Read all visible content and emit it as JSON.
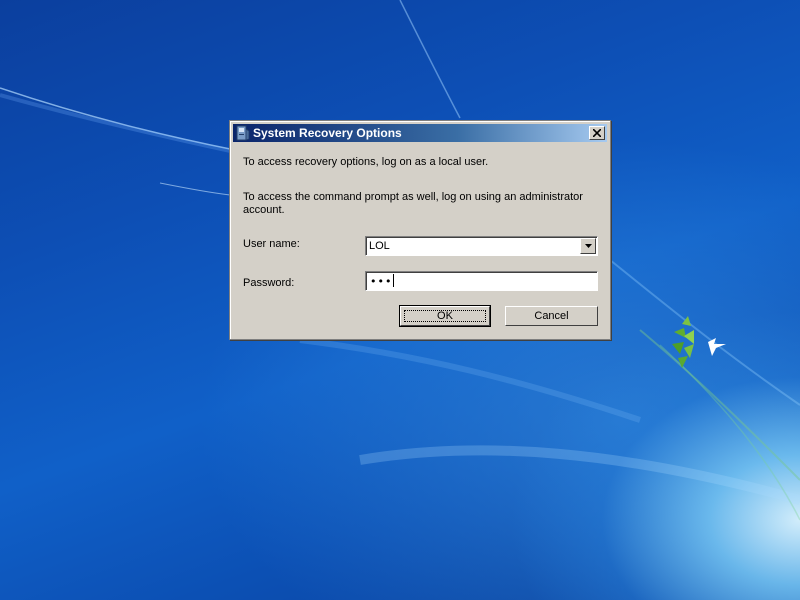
{
  "dialog": {
    "title": "System Recovery Options",
    "message_line1": "To access recovery options, log on as a local user.",
    "message_line2": "To access the command prompt as well, log on using an administrator account.",
    "username_label": "User name:",
    "username_value": "LOL",
    "password_label": "Password:",
    "password_masked": "•••",
    "ok_label": "OK",
    "cancel_label": "Cancel",
    "close_icon": "close-icon",
    "app_icon": "system-recovery-icon"
  },
  "colors": {
    "dialog_bg": "#d4d0c8",
    "titlebar_start": "#0a246a",
    "titlebar_end": "#a6caf0",
    "desktop_blue": "#0d4fb5"
  }
}
